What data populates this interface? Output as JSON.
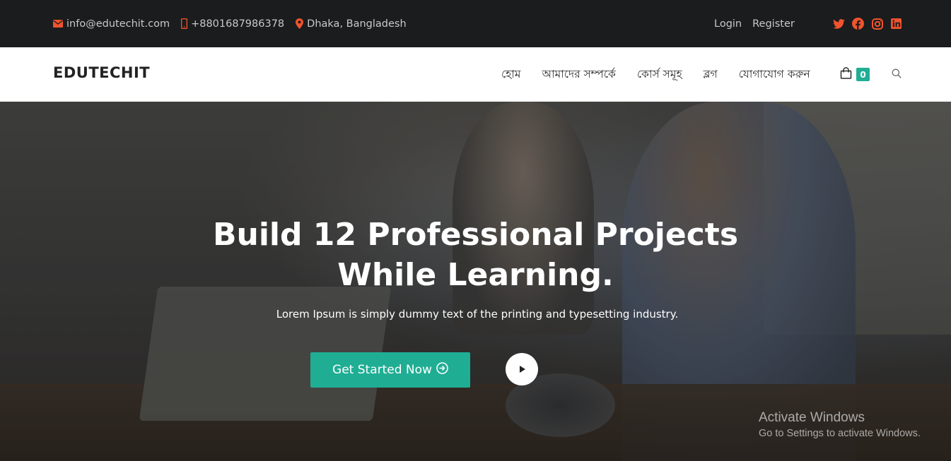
{
  "topbar": {
    "email": "info@edutechit.com",
    "phone": "+8801687986378",
    "location": "Dhaka, Bangladesh",
    "login": "Login",
    "register": "Register",
    "social_icons": [
      "twitter-icon",
      "facebook-icon",
      "instagram-icon",
      "linkedin-icon"
    ],
    "accent": "#f0542d"
  },
  "navbar": {
    "brand": "EDUTECHIT",
    "menu": [
      "হোম",
      "আমাদের সম্পর্কে",
      "কোর্স সমূহ",
      "ব্লগ",
      "যোগাযোগ করুন"
    ],
    "cart_count": "0"
  },
  "hero": {
    "title_line1": "Build 12 Professional Projects",
    "title_line2": "While Learning.",
    "subtitle": "Lorem Ipsum is simply dummy text of the printing and typesetting industry.",
    "cta_label": "Get Started Now",
    "cta_color": "#1fae94"
  },
  "watermark": {
    "title": "Activate Windows",
    "message": "Go to Settings to activate Windows."
  }
}
